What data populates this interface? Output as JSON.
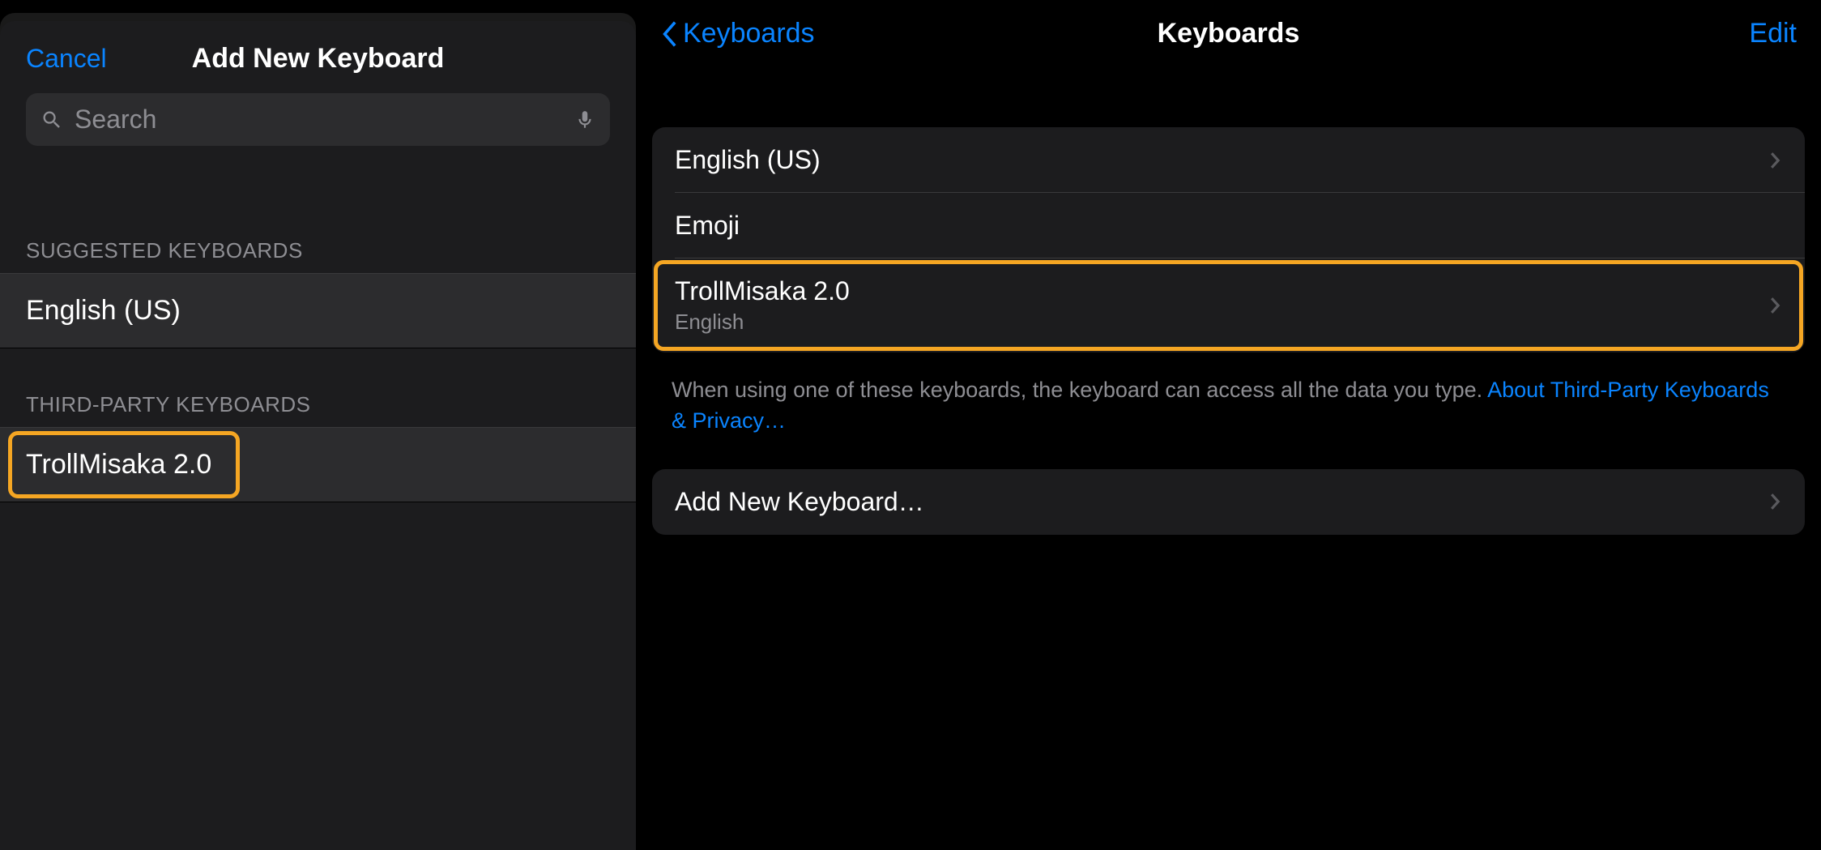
{
  "colors": {
    "accent": "#0a84ff",
    "highlight": "#f5a623"
  },
  "left": {
    "cancel": "Cancel",
    "title": "Add New Keyboard",
    "search_placeholder": "Search",
    "sections": {
      "suggested": {
        "header": "SUGGESTED KEYBOARDS",
        "items": [
          "English (US)"
        ]
      },
      "thirdparty": {
        "header": "THIRD-PARTY KEYBOARDS",
        "items": [
          "TrollMisaka 2.0"
        ]
      }
    }
  },
  "right": {
    "back_label": "Keyboards",
    "title": "Keyboards",
    "edit": "Edit",
    "keyboards": [
      {
        "title": "English (US)",
        "sub": null,
        "chevron": true
      },
      {
        "title": "Emoji",
        "sub": null,
        "chevron": false
      },
      {
        "title": "TrollMisaka 2.0",
        "sub": "English",
        "chevron": true,
        "highlighted": true
      }
    ],
    "footer_text": "When using one of these keyboards, the keyboard can access all the data you type. ",
    "footer_link": "About Third-Party Keyboards & Privacy…",
    "add_new": "Add New Keyboard…"
  }
}
